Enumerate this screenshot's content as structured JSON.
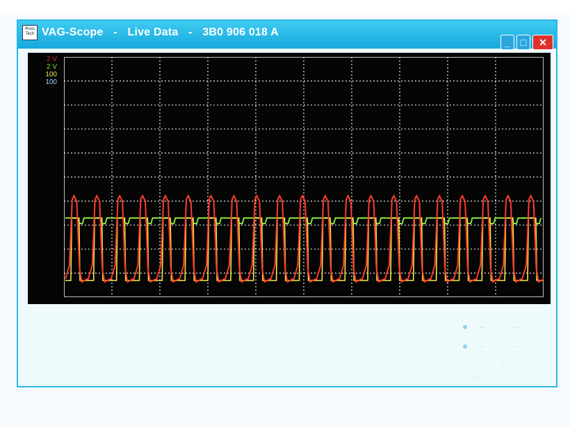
{
  "window": {
    "title_parts": [
      "VAG-Scope",
      "-",
      "Live Data",
      "-",
      "3B0 906 018 A"
    ],
    "icon_label": "Ross Tech",
    "controls": {
      "minimize": "_",
      "maximize": "□",
      "close": "✕"
    }
  },
  "scope": {
    "legend": [
      {
        "text": "2 V",
        "color": "#c8322b"
      },
      {
        "text": "2 V",
        "color": "#7de33a"
      },
      {
        "text": "100",
        "color": "#f0e94a"
      },
      {
        "text": "100",
        "color": "#9fd7ff"
      }
    ],
    "grid": {
      "vertical_divisions": 10,
      "horizontal_divisions": 10
    },
    "traces": {
      "red": {
        "color": "#ff3b2b",
        "cycles": 21
      },
      "yellow": {
        "color": "#f3e94a"
      },
      "green": {
        "color": "#7fe23b"
      }
    }
  },
  "status": {
    "row1_label": "...",
    "row1_value": "...",
    "row2_label": "...",
    "row2_value": "...",
    "row3_label": "...",
    "bottom_left": "...",
    "bottom_button": "..."
  },
  "colors": {
    "titlebar": "#1fb0e3",
    "scope_background": "#050505",
    "close_button": "#e0322b"
  }
}
